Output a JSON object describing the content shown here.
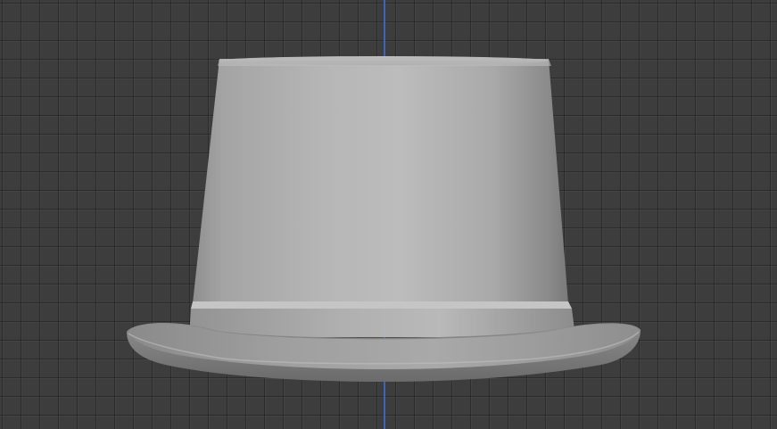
{
  "viewport": {
    "view": "3d-viewport",
    "grid": true,
    "axis_color": "#3a6fd0",
    "background_color": "#3d3d3d"
  },
  "object": {
    "kind": "top-hat-mesh",
    "material_color": "#b3b3b3"
  }
}
